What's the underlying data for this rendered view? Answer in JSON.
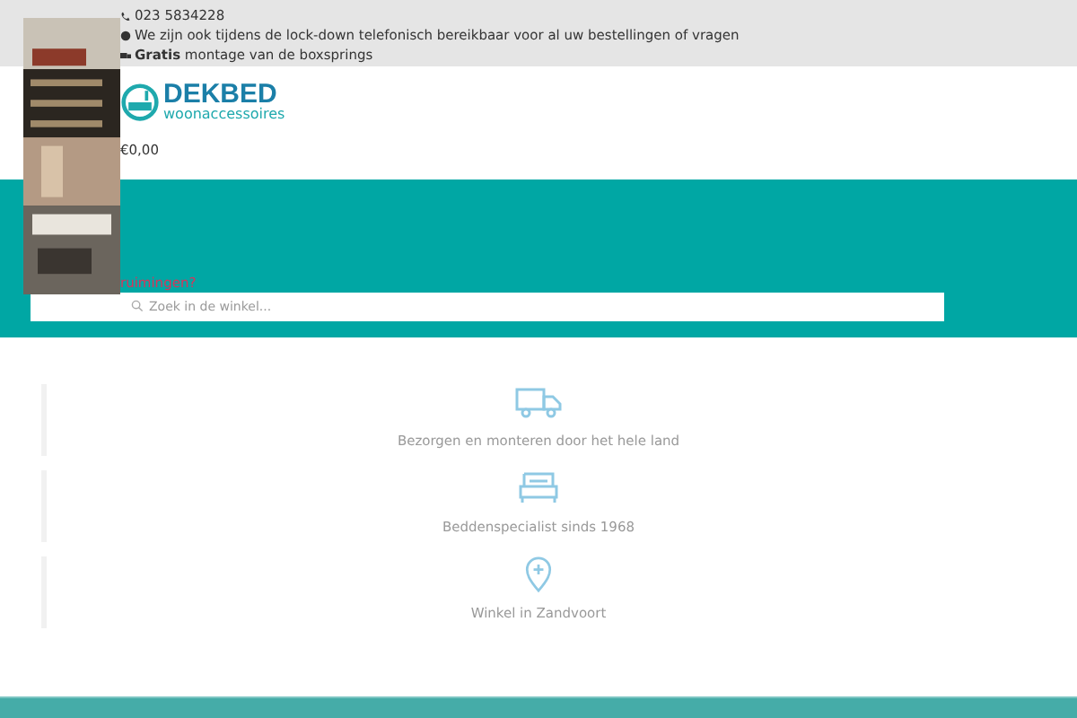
{
  "topbar": {
    "phone": "023 5834228",
    "notice": "We zijn ook tijdens de lock-down telefonisch bereikbaar voor al uw bestellingen of vragen",
    "promo": "**Gratis** montage van de boxsprings"
  },
  "header": {
    "logo_name": "DEKBED",
    "logo_sub": "woonaccessoires",
    "cart_total": "€0,00"
  },
  "banner": {
    "link": "ruimingen?",
    "search": {
      "placeholder": "Zoek in de winkel..."
    }
  },
  "features": [
    {
      "kind": "truck",
      "label": "Bezorgen en monteren door het hele land"
    },
    {
      "kind": "bed",
      "label": "Beddenspecialist sinds 1968"
    },
    {
      "kind": "pin",
      "label": "Winkel in Zandvoort"
    }
  ]
}
